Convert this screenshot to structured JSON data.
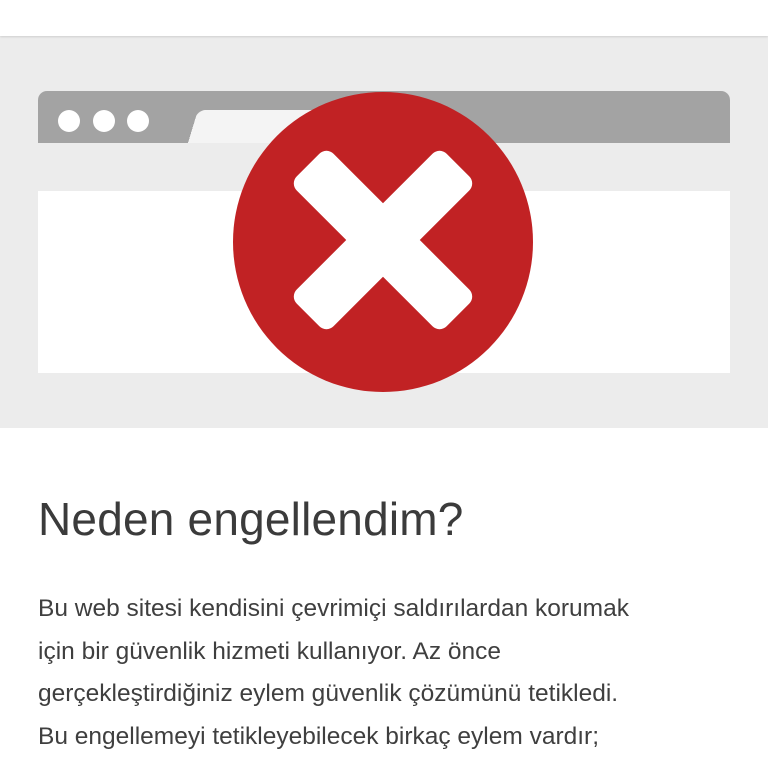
{
  "theme": {
    "accent_red": "#c12224",
    "hero_background": "#ececec",
    "browser_bar": "#a3a3a3"
  },
  "hero": {
    "icon": "block-x-icon",
    "browser_dots": [
      "dot",
      "dot",
      "dot"
    ]
  },
  "content": {
    "heading": "Neden engellendim?",
    "paragraph_lines": [
      "Bu web sitesi kendisini çevrimiçi saldırılardan korumak",
      "için bir güvenlik hizmeti kullanıyor. Az önce",
      "gerçekleştirdiğiniz eylem güvenlik çözümünü tetikledi.",
      "Bu engellemeyi tetikleyebilecek birkaç eylem vardır;"
    ]
  }
}
